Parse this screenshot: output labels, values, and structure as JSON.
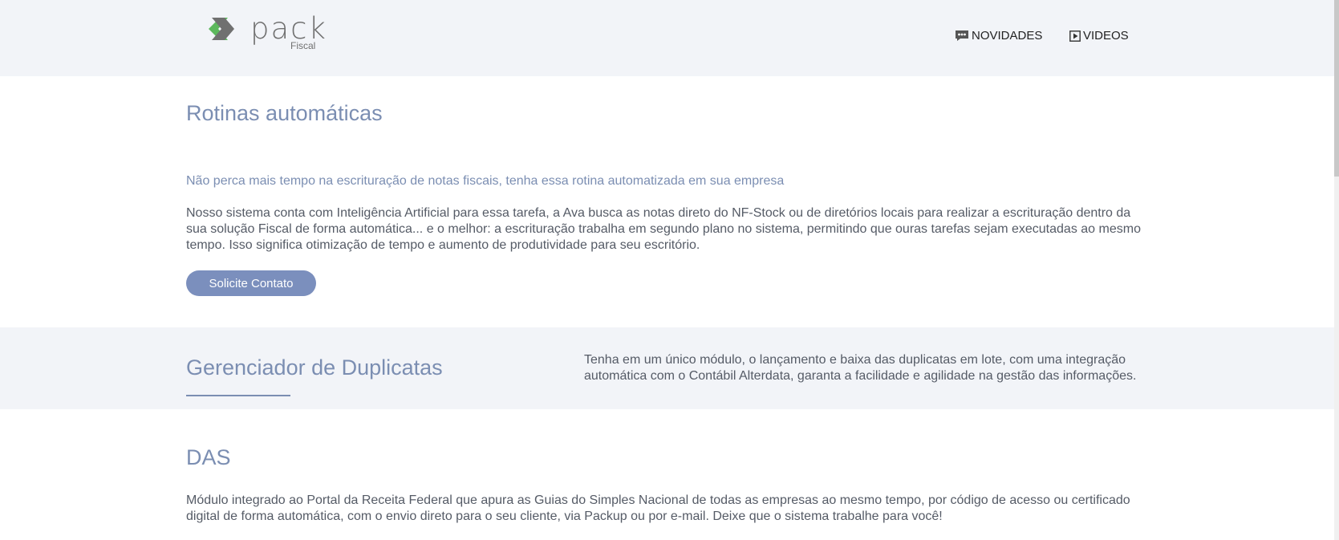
{
  "header": {
    "logo_text": "pack",
    "logo_subtitle": "Fiscal",
    "nav": [
      {
        "label": "NOVIDADES",
        "icon": "chat-icon"
      },
      {
        "label": "VIDEOS",
        "icon": "play-icon"
      }
    ]
  },
  "sections": {
    "rotinas": {
      "title": "Rotinas automáticas",
      "subtitle": "Não perca mais tempo na escrituração de notas fiscais, tenha essa rotina automatizada em sua empresa",
      "body": "Nosso sistema conta com Inteligência Artificial para essa tarefa, a Ava busca as notas direto do NF-Stock ou de diretórios locais para realizar a escrituração dentro da sua solução Fiscal de forma automática... e o melhor: a escrituração trabalha em segundo plano no sistema, permitindo que ouras tarefas sejam executadas ao mesmo tempo. Isso significa otimização de tempo e aumento de produtividade para seu escritório.",
      "button_label": "Solicite Contato"
    },
    "duplicatas": {
      "title": "Gerenciador de Duplicatas",
      "body": "Tenha em um único módulo, o lançamento e baixa das duplicatas em lote, com uma integração automática com o Contábil Alterdata, garanta a facilidade e agilidade na gestão das informações."
    },
    "das": {
      "title": "DAS",
      "body": "Módulo integrado ao Portal da Receita Federal que apura as Guias do Simples Nacional de todas as empresas ao mesmo tempo, por código de acesso ou certificado digital de forma automática, com o envio direto para o seu cliente, via Packup ou por e-mail. Deixe que o sistema trabalhe para você!"
    }
  },
  "colors": {
    "accent": "#7b8eb2",
    "button": "#7b8fbd",
    "header_bg": "#f2f4f8",
    "logo_green": "#5cb85c",
    "logo_gray": "#707070"
  }
}
